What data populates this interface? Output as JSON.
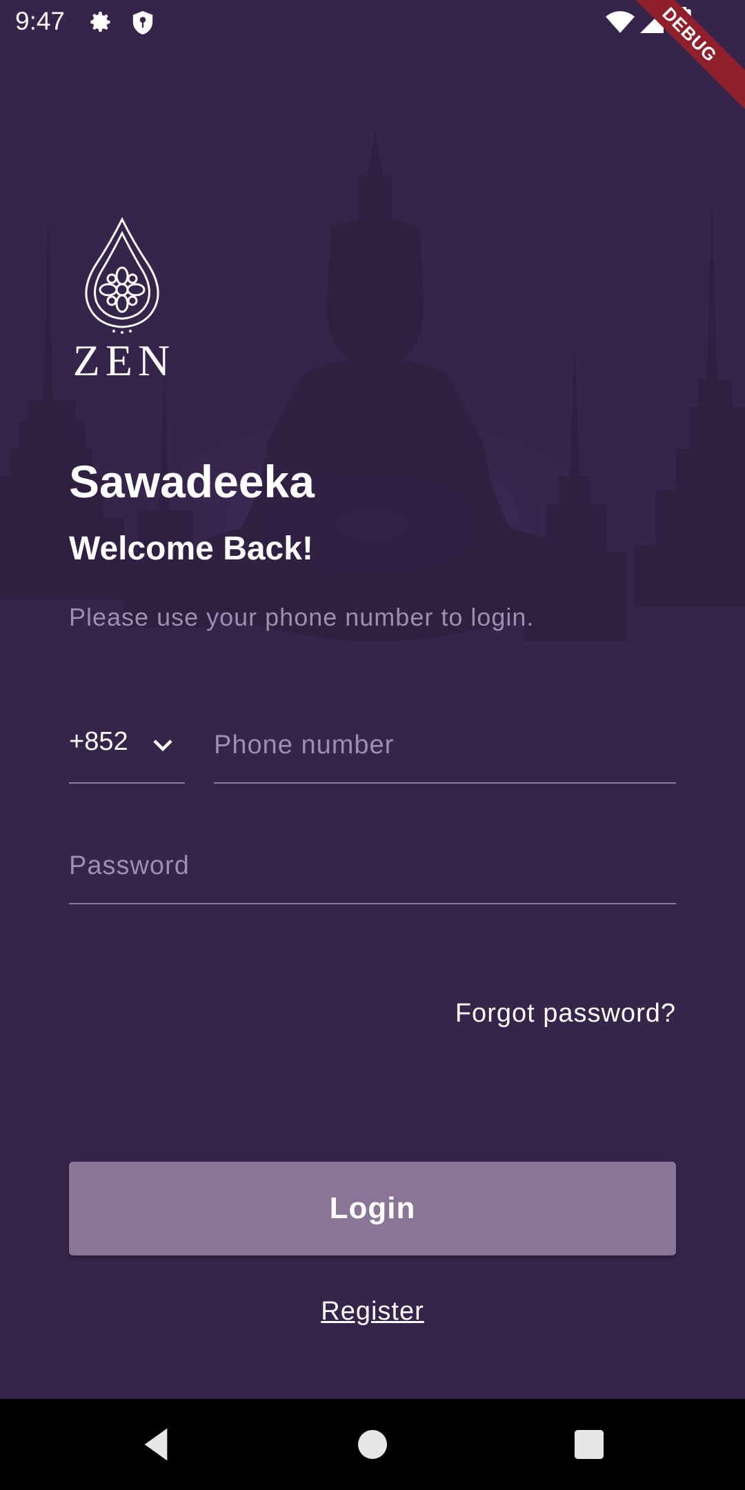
{
  "status_bar": {
    "time": "9:47",
    "icons": [
      "gear-icon",
      "shield-icon",
      "wifi-icon",
      "signal-icon",
      "battery-icon"
    ],
    "debug_banner": "DEBUG"
  },
  "logo": {
    "text": "ZEN",
    "icon": "lotus-drop-icon"
  },
  "greeting": "Sawadeeka",
  "welcome": "Welcome Back!",
  "instruction": "Please use your phone number to login.",
  "form": {
    "country_code": "+852",
    "phone_placeholder": "Phone number",
    "password_placeholder": "Password",
    "forgot_password": "Forgot password?"
  },
  "login_button": "Login",
  "register_link": "Register",
  "nav_bar": {
    "icons": [
      "back-icon",
      "home-icon",
      "recents-icon"
    ]
  },
  "colors": {
    "background": "#36244a",
    "button": "#8a7598",
    "muted_text": "#9d8fb0",
    "underline": "#8b7c9e",
    "debug_banner": "#8e1f2b"
  }
}
